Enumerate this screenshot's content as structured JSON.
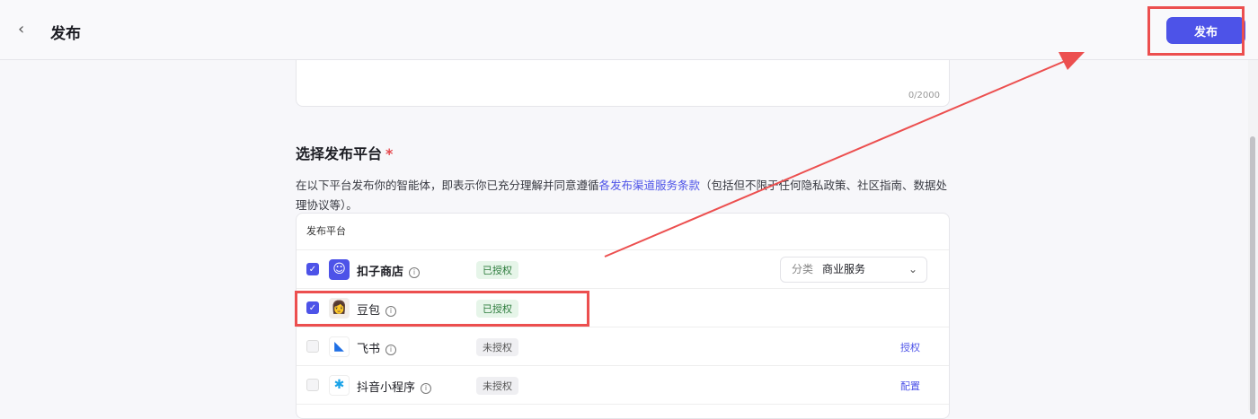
{
  "header": {
    "title": "发布",
    "publish_label": "发布"
  },
  "description_box": {
    "counter": "0/2000"
  },
  "section": {
    "title": "选择发布平台",
    "required_mark": "*",
    "desc_before": "在以下平台发布你的智能体，即表示你已充分理解并同意遵循",
    "desc_link": "各发布渠道服务条款",
    "desc_after": "（包括但不限于任何隐私政策、社区指南、数据处理协议等）。"
  },
  "table": {
    "header": "发布平台",
    "rows": [
      {
        "name": "扣子商店",
        "status": "已授权",
        "checked": true,
        "category_label": "分类",
        "category_value": "商业服务"
      },
      {
        "name": "豆包",
        "status": "已授权",
        "checked": true
      },
      {
        "name": "飞书",
        "status": "未授权",
        "checked": false,
        "action": "授权"
      },
      {
        "name": "抖音小程序",
        "status": "未授权",
        "checked": false,
        "action": "配置"
      }
    ]
  },
  "colors": {
    "accent": "#4d53e8",
    "annotation": "#ec4f4f"
  }
}
